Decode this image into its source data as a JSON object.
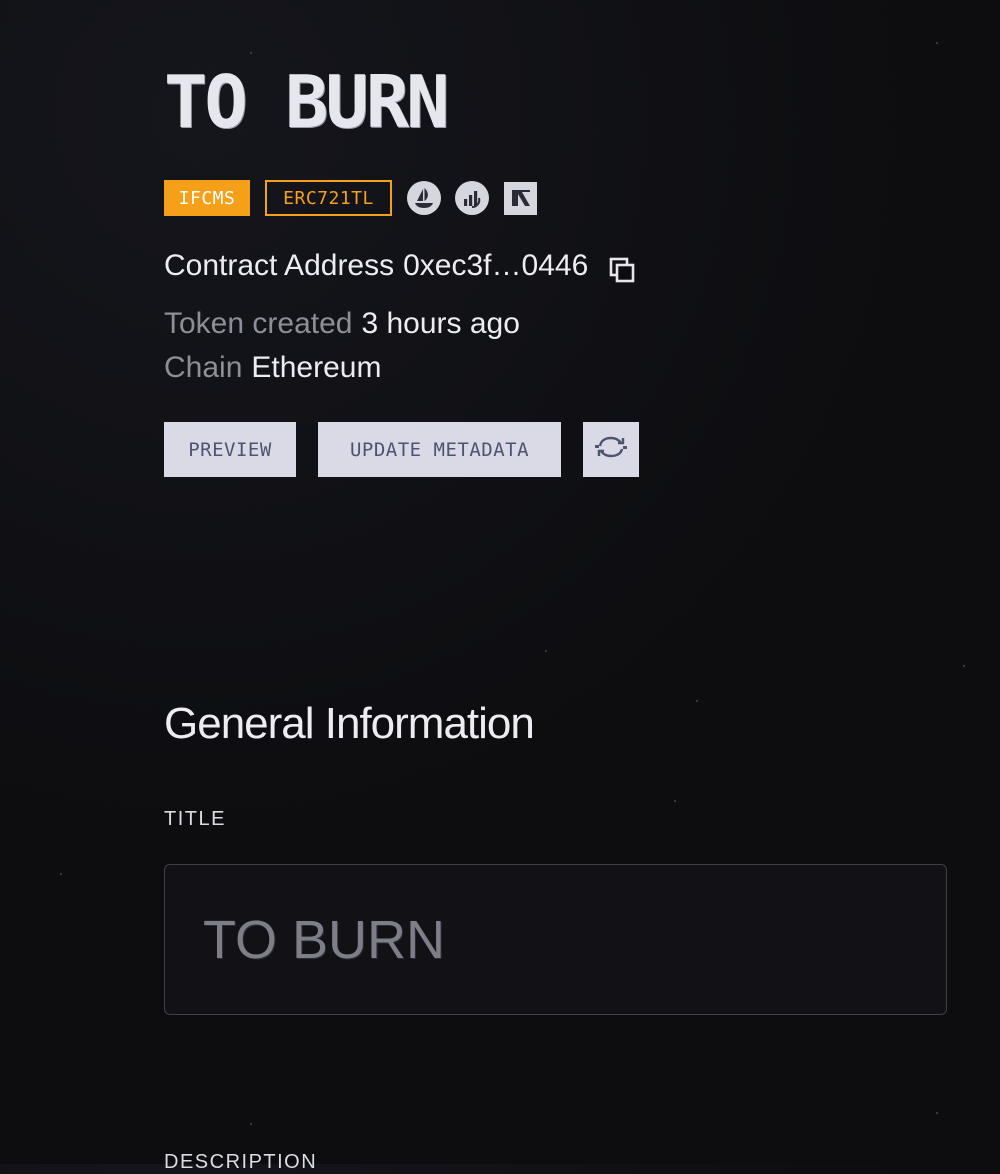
{
  "header": {
    "title": "TO BURN"
  },
  "badges": {
    "protocol": "IFCMS",
    "standard": "ERC721TL"
  },
  "marketplaces": [
    {
      "icon": "opensea-icon"
    },
    {
      "icon": "chart-icon"
    },
    {
      "icon": "marketplace-icon"
    }
  ],
  "contract": {
    "label": "Contract Address",
    "address": "0xec3f…0446"
  },
  "token": {
    "created_label": "Token created",
    "created_value": "3 hours ago",
    "chain_label": "Chain",
    "chain_value": "Ethereum"
  },
  "actions": {
    "preview": "PREVIEW",
    "update_metadata": "UPDATE METADATA",
    "refresh_icon": "refresh-icon"
  },
  "general": {
    "heading": "General Information",
    "title_label": "TITLE",
    "title_value": "TO BURN",
    "description_label": "DESCRIPTION"
  },
  "colors": {
    "accent": "#f6a01a",
    "background": "#0d0d10",
    "button_bg": "#d9dae6",
    "button_text": "#4e5470"
  }
}
